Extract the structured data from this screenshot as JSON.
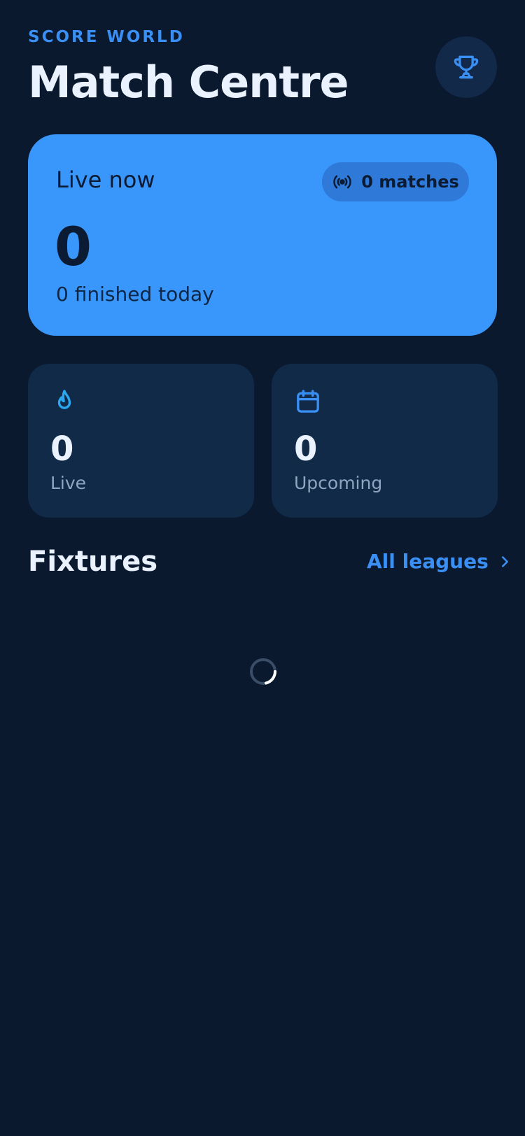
{
  "header": {
    "brand": "SCORE WORLD",
    "title": "Match Centre",
    "trophy_icon": "trophy-icon"
  },
  "hero": {
    "label": "Live now",
    "badge_text": "0 matches",
    "badge_icon": "broadcast-icon",
    "value": "0",
    "subtitle": "0 finished today"
  },
  "stats": [
    {
      "icon": "flame-icon",
      "value": "0",
      "label": "Live"
    },
    {
      "icon": "calendar-icon",
      "value": "0",
      "label": "Upcoming"
    }
  ],
  "fixtures": {
    "title": "Fixtures",
    "link_label": "All leagues",
    "loading": true
  },
  "colors": {
    "background": "#0a192e",
    "accent": "#3a8ff5",
    "hero_card": "#3996fb",
    "card": "#112a48",
    "live_icon": "#2aa8f0"
  }
}
